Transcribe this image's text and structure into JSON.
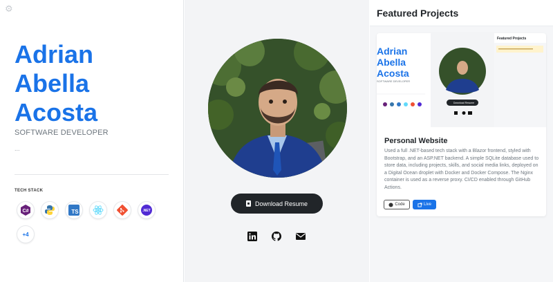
{
  "profile": {
    "name_lines": [
      "Adrian",
      "Abella",
      "Acosta"
    ],
    "role": "SOFTWARE DEVELOPER",
    "bio": "..."
  },
  "tech_stack": {
    "title": "TECH STACK",
    "items": [
      {
        "icon": "csharp-icon",
        "label": "C#",
        "color": "#68217a"
      },
      {
        "icon": "python-icon",
        "label": "",
        "color": "#3776ab"
      },
      {
        "icon": "typescript-icon",
        "label": "TS",
        "color": "#3178c6"
      },
      {
        "icon": "react-icon",
        "label": "",
        "color": "#61dafb"
      },
      {
        "icon": "git-icon",
        "label": "",
        "color": "#f05032"
      },
      {
        "icon": "dotnet-icon",
        "label": ".NET",
        "color": "#512bd4"
      }
    ],
    "more": "+4"
  },
  "resume": {
    "label": "Download Resume"
  },
  "social": [
    "linkedin-icon",
    "github-icon",
    "email-icon"
  ],
  "projects": {
    "title": "Featured Projects",
    "card": {
      "title": "Personal Website",
      "description": "Used a full .NET-based tech stack with a Blazor frontend, styled with Bootstrap, and an ASP.NET backend. A simple SQLite database used to store data, including projects, skills, and social media links, deployed on a Digital Ocean droplet with Docker and Docker Compose. The Nginx container is used as a reverse proxy. CI/CD enabled through GitHub Actions.",
      "code_label": "Code",
      "live_label": "Live",
      "preview": {
        "name_lines": [
          "Adrian",
          "Abella",
          "Acosta"
        ],
        "role": "SOFTWARE DEVELOPER",
        "resume_label": "Download Resume",
        "side_title": "Featured Projects"
      }
    }
  },
  "colors": {
    "accent": "#1a73e8",
    "dark_button": "#212529"
  }
}
